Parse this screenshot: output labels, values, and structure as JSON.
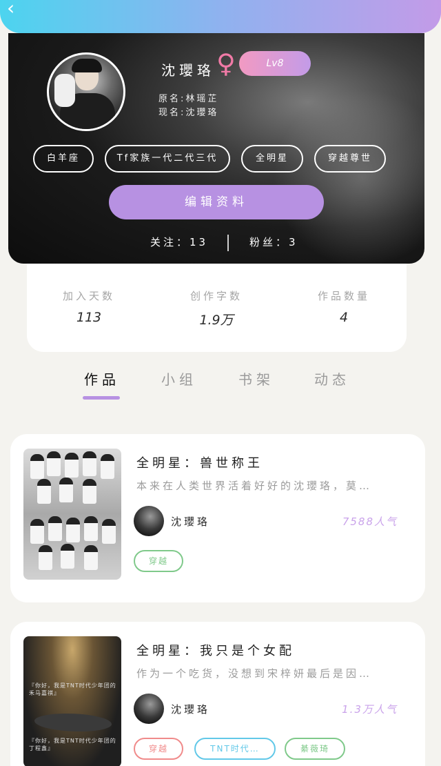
{
  "header": {
    "back_icon": "chevron-left-icon"
  },
  "profile": {
    "name": "沈瓔珞",
    "gender_symbol": "♀",
    "level": "Lv8",
    "original_name": "原名:林瑶芷",
    "current_name": "现名:沈瓔珞",
    "tags": [
      "白羊座",
      "Tf家族一代二代三代",
      "全明星",
      "穿越尊世"
    ],
    "edit_button": "编辑资料",
    "following": "关注：13",
    "followers": "粉丝：3"
  },
  "stats": [
    {
      "label": "加入天数",
      "value": "113"
    },
    {
      "label": "创作字数",
      "value": "1.9万"
    },
    {
      "label": "作品数量",
      "value": "4"
    }
  ],
  "tabs": [
    "作品",
    "小组",
    "书架",
    "动态"
  ],
  "works": [
    {
      "title": "全明星：兽世称王",
      "desc": "本来在人类世界活着好好的沈瓔珞，莫…",
      "author": "沈瓔珞",
      "popularity": "7588人气",
      "chips": [
        {
          "label": "穿越",
          "color": "#7fc98a"
        }
      ]
    },
    {
      "title": "全明星：我只是个女配",
      "desc": "作为一个吃货，没想到宋梓妍最后是因…",
      "author": "沈瓔珞",
      "popularity": "1.3万人气",
      "chips": [
        {
          "label": "穿越",
          "color": "#f08a8a"
        },
        {
          "label": "TNT时代…",
          "color": "#61c8e8"
        },
        {
          "label": "綦薇琦",
          "color": "#7fc98a"
        }
      ],
      "cover_text_1": "『你好，我是TNT时代少年团的禾马嘉祺』",
      "cover_text_2": "『你好，我是TNT时代少年团的丁程鑫』"
    }
  ],
  "colors": {
    "accent": "#b791e2",
    "female": "#f07aa6",
    "popularity": "#c9a2ea"
  }
}
